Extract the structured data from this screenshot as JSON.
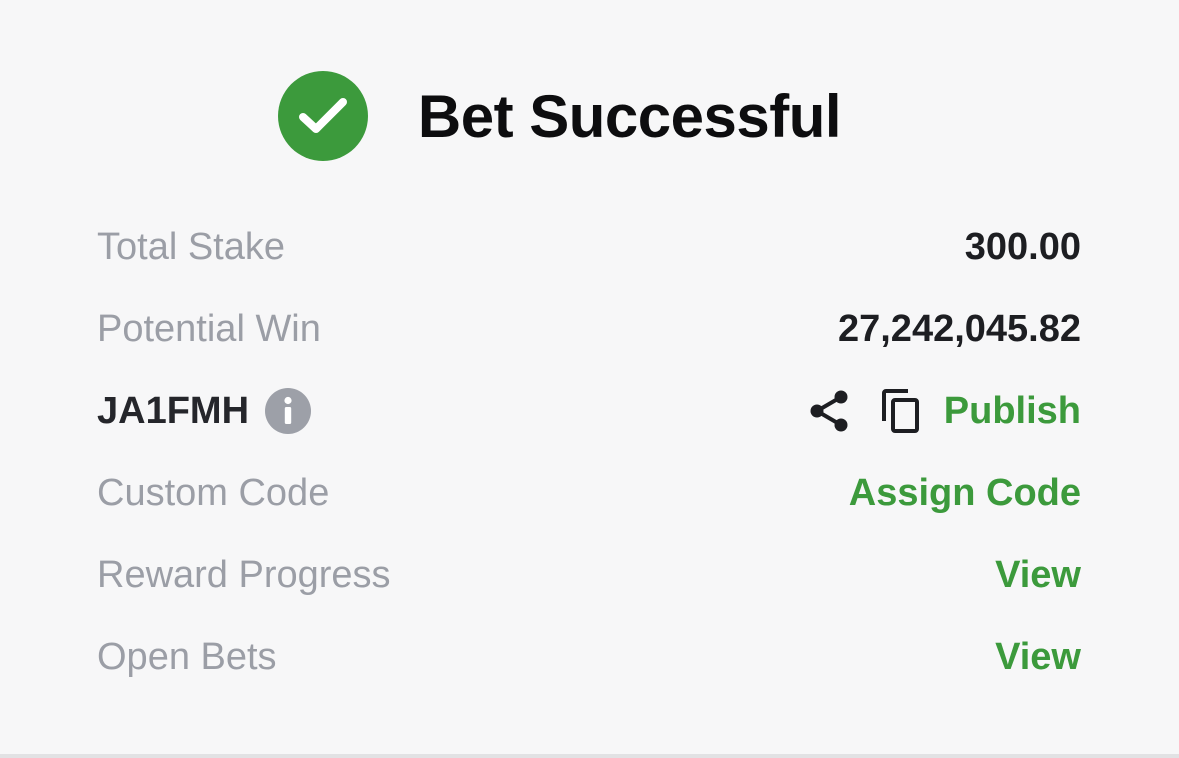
{
  "header": {
    "title": "Bet Successful"
  },
  "rows": {
    "total_stake": {
      "label": "Total Stake",
      "value": "300.00"
    },
    "potential_win": {
      "label": "Potential Win",
      "value": "27,242,045.82"
    },
    "booking": {
      "code": "JA1FMH",
      "publish_label": "Publish"
    },
    "custom_code": {
      "label": "Custom Code",
      "action": "Assign Code"
    },
    "reward_progress": {
      "label": "Reward Progress",
      "action": "View"
    },
    "open_bets": {
      "label": "Open Bets",
      "action": "View"
    }
  },
  "icons": {
    "success": "check-circle-icon",
    "info": "info-icon",
    "share": "share-icon",
    "copy": "copy-icon"
  },
  "colors": {
    "accent_green": "#3c9a3c",
    "label_gray": "#9b9ea6",
    "text_dark": "#1d1e22",
    "background": "#f7f7f8"
  }
}
